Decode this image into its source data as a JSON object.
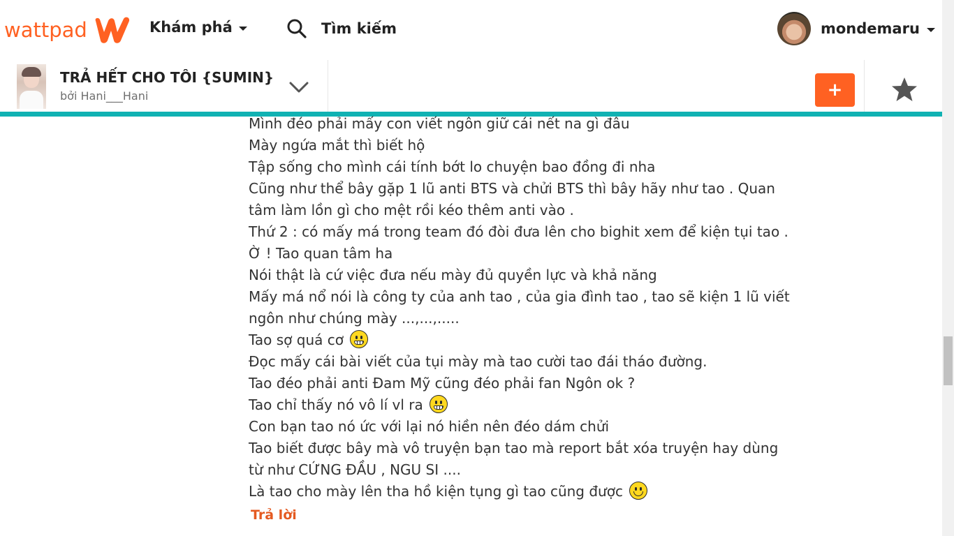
{
  "nav": {
    "logo_text": "wattpad",
    "discover_label": "Khám phá",
    "search_placeholder": "Tìm kiếm",
    "username": "mondemaru"
  },
  "story": {
    "title": "TRẢ HẾT CHO TÔI {SUMIN}",
    "author": "bởi Hani___Hani",
    "add_label": "+"
  },
  "content": {
    "lines": [
      {
        "text": "Mình đéo phải mấy con viết ngôn giữ cái nết na gì đâu"
      },
      {
        "text": "Mày ngứa mắt thì biết hộ"
      },
      {
        "text": "Tập sống cho mình cái tính bớt lo chuyện bao đồng đi nha"
      },
      {
        "text": "Cũng như thể bây gặp 1 lũ anti BTS và chửi BTS thì bây hãy như tao . Quan"
      },
      {
        "text": "tâm làm lồn gì cho mệt rồi kéo thêm anti vào ."
      },
      {
        "text": "Thứ 2 : có mấy má trong team đó đòi đưa lên cho bighit xem để kiện tụi tao ."
      },
      {
        "text": "Ờ ! Tao quan tâm ha"
      },
      {
        "text": "Nói thật là cứ việc đưa nếu mày đủ quyền lực và khả năng"
      },
      {
        "text": "Mấy má nổ nói là công ty của anh tao , của gia đình tao , tao sẽ kiện 1 lũ viết"
      },
      {
        "text": "ngôn như chúng mày ...,...,....."
      },
      {
        "text": "Tao sợ quá cơ ",
        "emoji": "grimace-emoji"
      },
      {
        "text": "Đọc mấy cái bài viết của tụi mày mà tao cười tao đái tháo đường."
      },
      {
        "text": "Tao đéo phải anti Đam Mỹ cũng đéo phải fan Ngôn ok ?"
      },
      {
        "text": "Tao chỉ thấy nó vô lí vl ra  ",
        "emoji": "grimace-emoji"
      },
      {
        "text": "Con bạn tao nó ức với lại nó hiền nên đéo dám chửi"
      },
      {
        "text": "Tao biết được bây mà vô truyện bạn tao mà report bắt xóa truyện hay dùng"
      },
      {
        "text": "từ như CỨNG ĐẦU , NGU SI ...."
      },
      {
        "text": "Là tao cho mày lên tha hồ kiện tụng gì tao cũng được ",
        "emoji": "smile-emoji"
      }
    ],
    "reply_label": "Trả lời"
  },
  "colors": {
    "brand": "#ff6122",
    "teal": "#10b2b3",
    "reply": "#e45a21"
  }
}
